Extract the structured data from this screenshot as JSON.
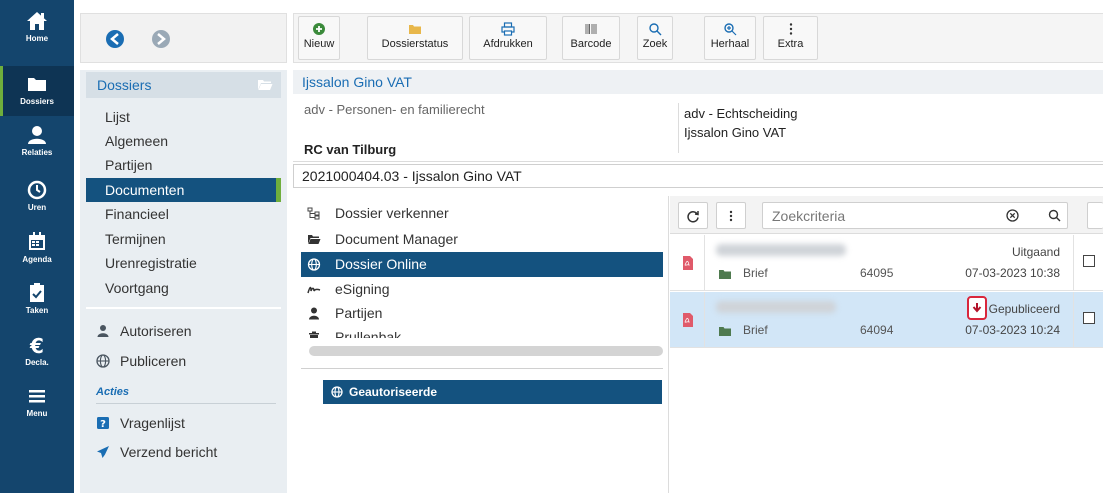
{
  "rail": [
    {
      "key": "home",
      "label": "Home",
      "icon": "home-icon"
    },
    {
      "key": "dossiers",
      "label": "Dossiers",
      "icon": "folder-icon",
      "active": true
    },
    {
      "key": "relaties",
      "label": "Relaties",
      "icon": "person-icon"
    },
    {
      "key": "uren",
      "label": "Uren",
      "icon": "clock-icon"
    },
    {
      "key": "agenda",
      "label": "Agenda",
      "icon": "calendar-icon"
    },
    {
      "key": "taken",
      "label": "Taken",
      "icon": "clipboard-icon"
    },
    {
      "key": "decla",
      "label": "Decla.",
      "icon": "euro-icon"
    },
    {
      "key": "menu",
      "label": "Menu",
      "icon": "hamburger-icon"
    }
  ],
  "toolbar": {
    "nieuw": "Nieuw",
    "dossierstatus": "Dossierstatus",
    "afdrukken": "Afdrukken",
    "barcode": "Barcode",
    "zoek": "Zoek",
    "herhaal": "Herhaal",
    "extra": "Extra"
  },
  "sidebar": {
    "header": "Dossiers",
    "items": [
      "Lijst",
      "Algemeen",
      "Partijen",
      "Documenten",
      "Financieel",
      "Termijnen",
      "Urenregistratie",
      "Voortgang"
    ],
    "active_index": 3,
    "actions": [
      "Autoriseren",
      "Publiceren"
    ],
    "acties_label": "Acties",
    "acties": [
      "Vragenlijst",
      "Verzend bericht"
    ]
  },
  "main": {
    "title": "Ijssalon Gino VAT",
    "category": "adv - Personen- en familierecht",
    "handler": "RC van Tilburg",
    "type": "adv - Echtscheiding",
    "client": "Ijssalon Gino VAT",
    "dossier_line": "2021000404.03 - Ijssalon Gino VAT"
  },
  "tree": {
    "items": [
      {
        "label": "Dossier verkenner",
        "icon": "tree-icon"
      },
      {
        "label": "Document Manager",
        "icon": "folder-open-icon"
      },
      {
        "label": "Dossier Online",
        "icon": "globe-icon",
        "active": true
      },
      {
        "label": "eSigning",
        "icon": "signature-icon"
      },
      {
        "label": "Partijen",
        "icon": "person-icon"
      },
      {
        "label": "Prullenbak",
        "icon": "trash-icon"
      }
    ],
    "authorized_label": "Geautoriseerde"
  },
  "docs": {
    "search_placeholder": "Zoekcriteria",
    "rows": [
      {
        "type": "Brief",
        "number": "64095",
        "status": "Uitgaand",
        "date": "07-03-2023 10:38",
        "selected": false
      },
      {
        "type": "Brief",
        "number": "64094",
        "status": "Gepubliceerd",
        "date": "07-03-2023 10:24",
        "selected": true
      }
    ]
  },
  "colors": {
    "rail": "#14456d",
    "accent": "#14527f",
    "active_marker": "#6fae3c",
    "link": "#1a6db3",
    "selection": "#d2e6f7",
    "highlight": "#d9263c"
  }
}
